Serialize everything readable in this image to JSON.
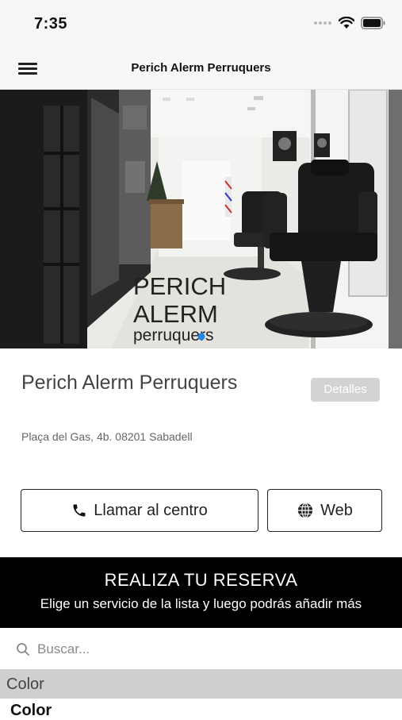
{
  "status_bar": {
    "time": "7:35",
    "icons": [
      "signal-icon",
      "wifi-icon",
      "battery-icon"
    ]
  },
  "nav": {
    "title": "Perich Alerm Perruquers",
    "menu_icon": "hamburger-menu-icon"
  },
  "hero": {
    "logo_line1": "PERICH",
    "logo_line2": "ALERM",
    "logo_line3": "perruquers",
    "carousel_active_index": 0
  },
  "center": {
    "name": "Perich Alerm Perruquers",
    "details_label": "Detalles",
    "address": "Plaça del Gas, 4b. 08201 Sabadell"
  },
  "actions": {
    "call_label": "Llamar al centro",
    "call_icon": "phone-icon",
    "web_label": "Web",
    "web_icon": "globe-icon"
  },
  "booking": {
    "title": "REALIZA TU RESERVA",
    "subtitle": "Elige un servicio de la lista y luego podrás añadir más"
  },
  "search": {
    "placeholder": "Buscar..."
  },
  "services": {
    "section_title": "Color",
    "first_item": "Color"
  },
  "colors": {
    "booking_bg": "#000000",
    "section_bg": "#cfcfcf",
    "details_bg": "#d3d3d3",
    "carousel_dot": "#1e88e5"
  }
}
